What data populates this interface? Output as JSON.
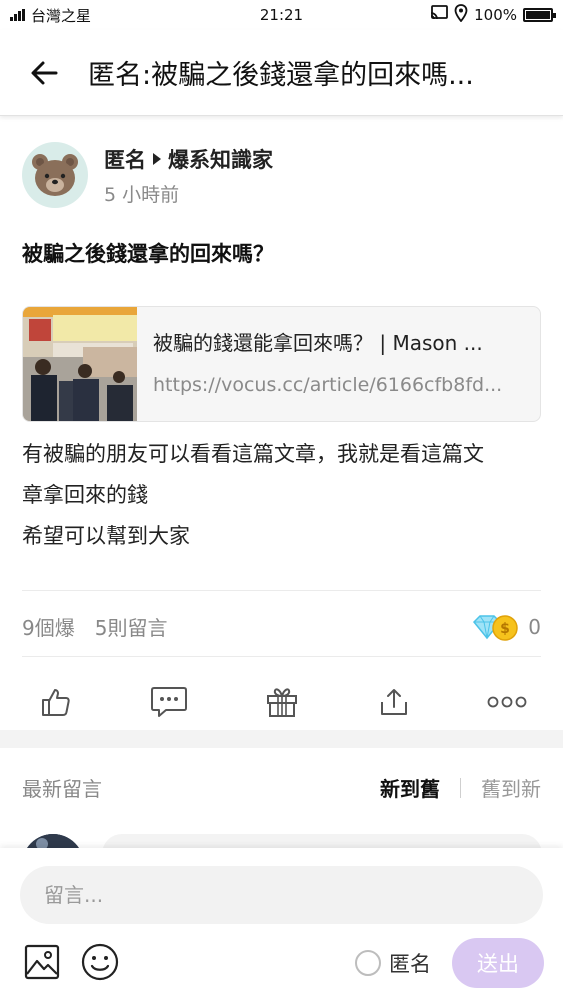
{
  "status_bar": {
    "signal": "⁴⁶",
    "carrier": "台灣之星",
    "time": "21:21",
    "battery": "100%"
  },
  "app_bar": {
    "title": "匿名:被騙之後錢還拿的回來嗎..."
  },
  "post": {
    "author": "匿名",
    "board": "爆系知識家",
    "time_ago": "5 小時前",
    "title": "被騙之後錢還拿的回來嗎？",
    "link_card": {
      "title": "被騙的錢還能拿回來嗎？ | Mason ...",
      "url": "https://vocus.cc/article/6166cfb8fd..."
    },
    "body_lines": [
      "有被騙的朋友可以看看這篇文章，我就是看這篇文",
      "章拿回來的錢",
      "希望可以幫到大家"
    ],
    "stats": {
      "likes": "9個爆",
      "comments": "5則留言",
      "coins": "0"
    }
  },
  "comments": {
    "label": "最新留言",
    "sort_new": "新到舊",
    "sort_old": "舊到新"
  },
  "composer": {
    "placeholder": "留言...",
    "anonymous_label": "匿名",
    "send_label": "送出"
  },
  "colors": {
    "send_button": "#d9c8f2",
    "avatar_bg": "#d9ece9",
    "muted_text": "#8a8a8a"
  }
}
